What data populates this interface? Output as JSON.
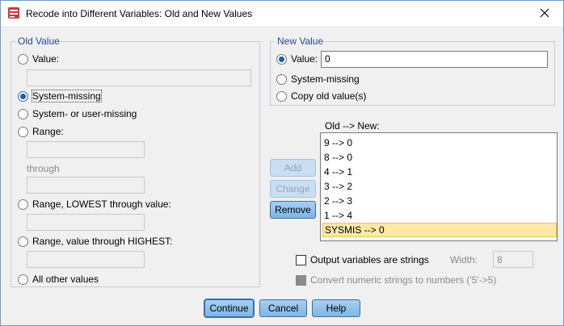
{
  "window": {
    "title": "Recode into Different Variables: Old and New Values"
  },
  "old_value": {
    "group_label": "Old Value",
    "value_label": "Value:",
    "system_missing_label": "System-missing",
    "system_or_user_missing_label": "System- or user-missing",
    "range_label": "Range:",
    "through_label": "through",
    "range_lowest_label": "Range, LOWEST through value:",
    "range_highest_label": "Range, value through HIGHEST:",
    "all_other_label": "All other values",
    "selected": "System-missing"
  },
  "new_value": {
    "group_label": "New Value",
    "value_label": "Value:",
    "value_input": "0",
    "system_missing_label": "System-missing",
    "copy_old_label": "Copy old value(s)",
    "selected": "Value"
  },
  "mapping": {
    "label": "Old --> New:",
    "items": [
      "9 --> 0",
      "8 --> 0",
      "4 --> 1",
      "3 --> 2",
      "2 --> 3",
      "1 --> 4",
      "SYSMIS --> 0"
    ],
    "selected_item": "SYSMIS --> 0"
  },
  "buttons": {
    "add": "Add",
    "change": "Change",
    "remove": "Remove",
    "continue": "Continue",
    "cancel": "Cancel",
    "help": "Help"
  },
  "options": {
    "output_strings_label": "Output variables are strings",
    "width_label": "Width:",
    "width_value": "8",
    "convert_label": "Convert numeric strings to numbers ('5'->5)"
  },
  "colors": {
    "accent": "#25479d",
    "selection": "#fde8a8",
    "button": "#a8cff0"
  }
}
